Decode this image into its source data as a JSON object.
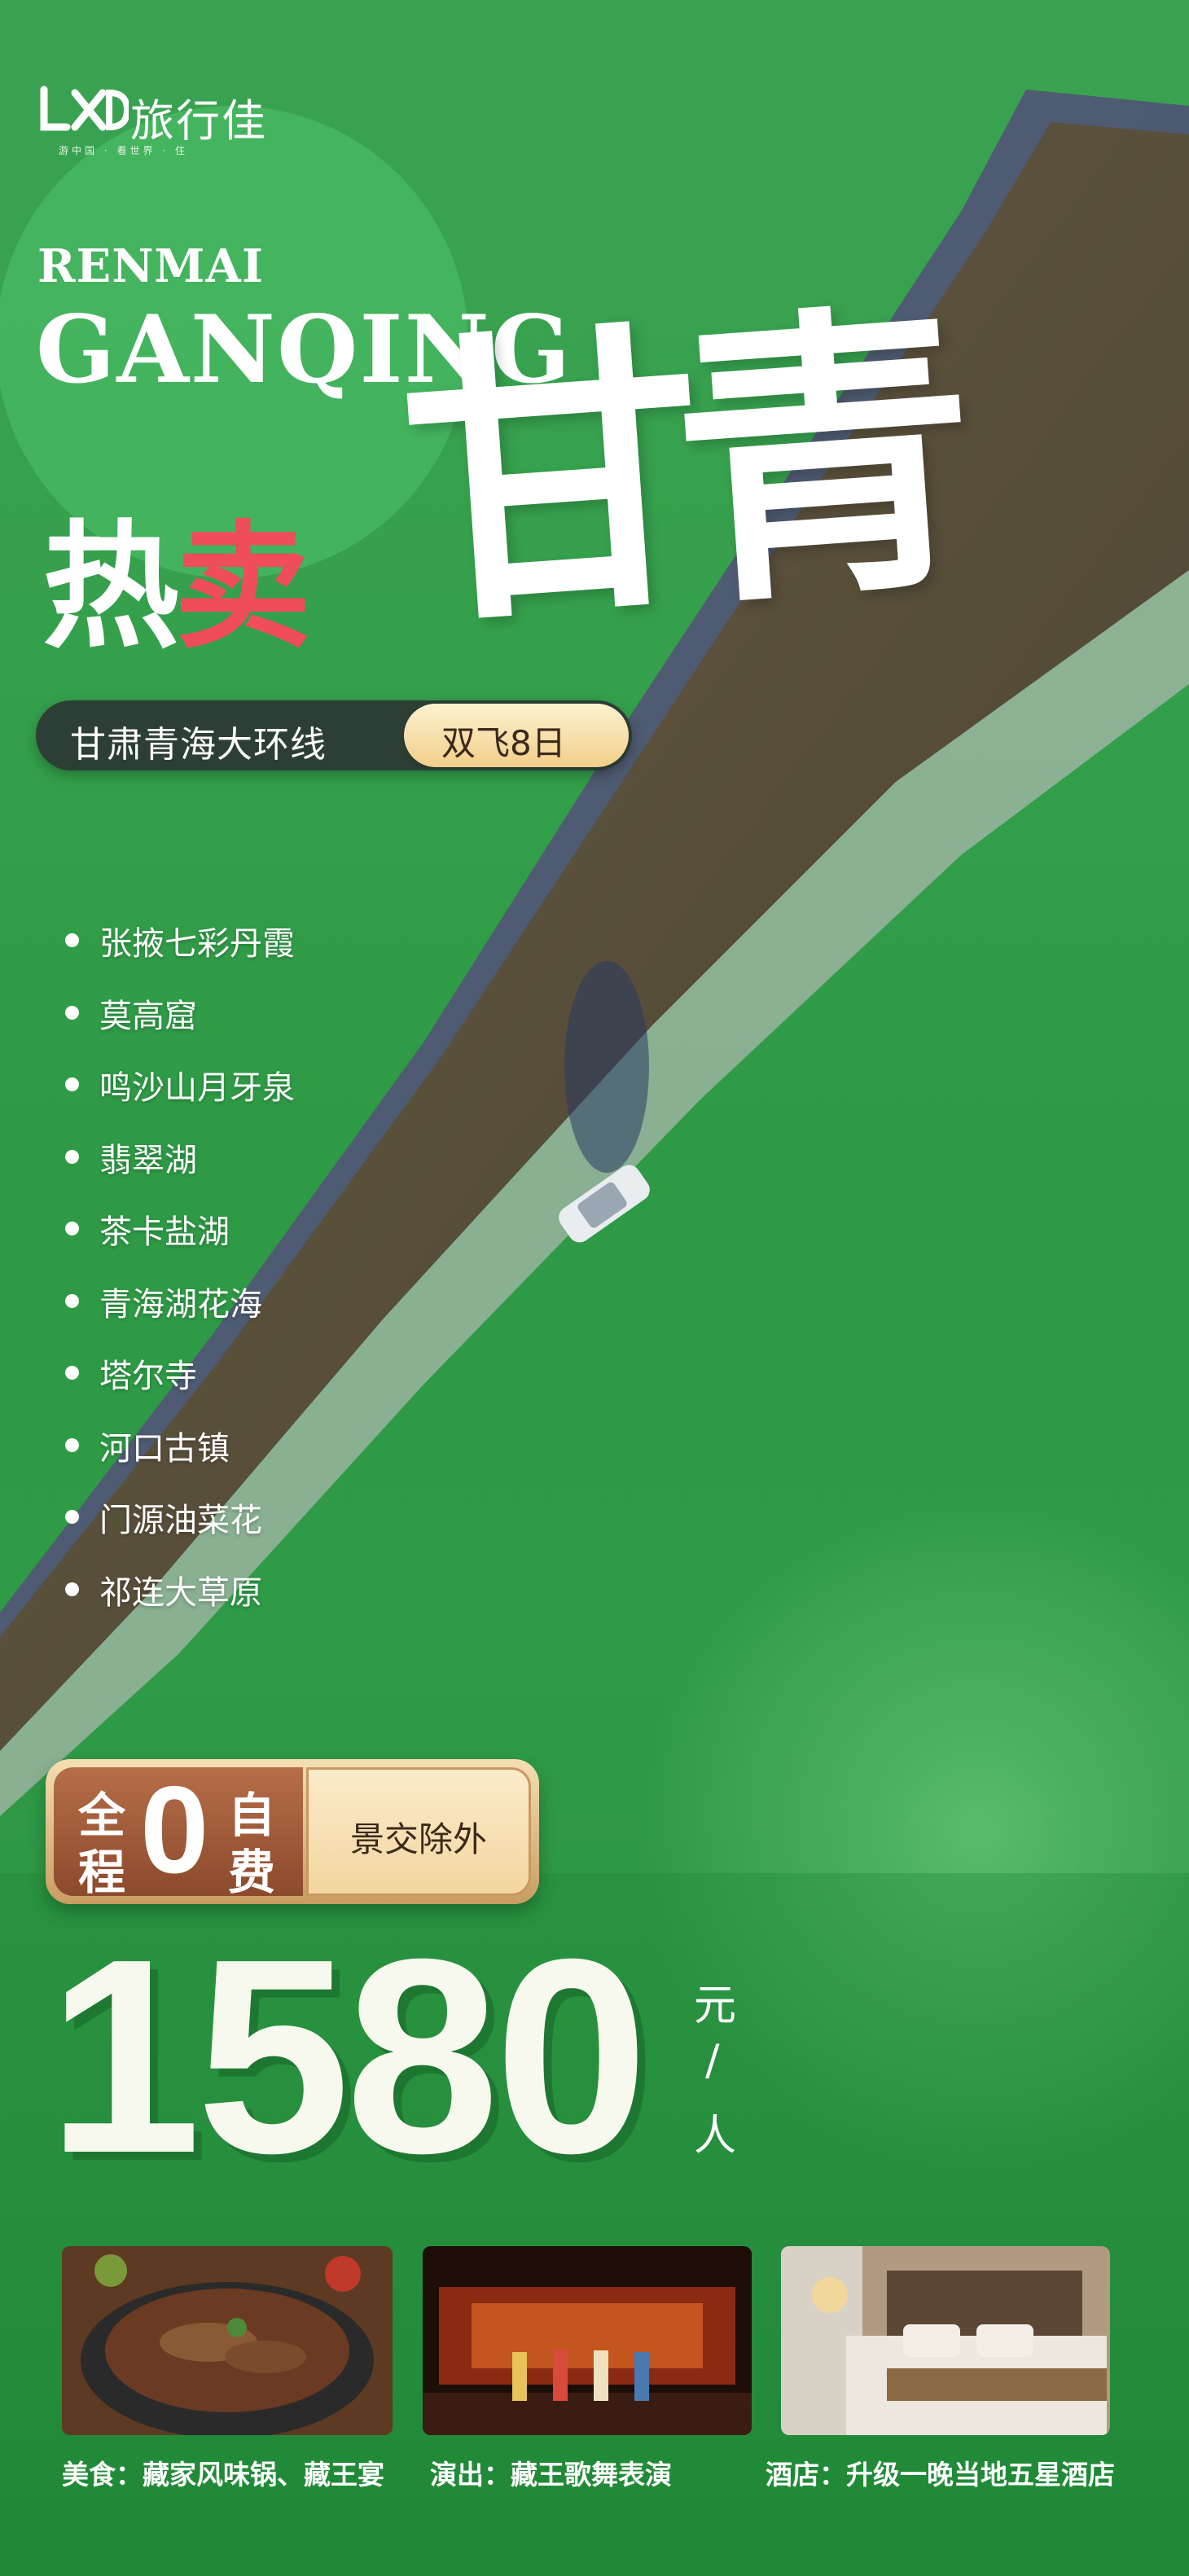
{
  "brand": {
    "logo_text": "旅行佳",
    "slogan": "游中国 · 看世界 · 住"
  },
  "headline": {
    "en_line1": "RENMAI",
    "en_line2": "GANQING",
    "hot_white": "热",
    "hot_red": "卖",
    "title": "甘青"
  },
  "route": {
    "name": "甘肃青海大环线",
    "tag": "双飞8日"
  },
  "spots": [
    "张掖七彩丹霞",
    "莫高窟",
    "鸣沙山月牙泉",
    "翡翠湖",
    "茶卡盐湖",
    "青海湖花海",
    "塔尔寺",
    "河口古镇",
    "门源油菜花",
    "祁连大草原"
  ],
  "badge": {
    "chars": {
      "quan": "全",
      "cheng": "程",
      "zi": "自",
      "fei": "费"
    },
    "zero": "0",
    "note": "景交除外"
  },
  "price": {
    "value": "1580",
    "unit_yuan": "元",
    "unit_slash": "/",
    "unit_ren": "人"
  },
  "features": [
    {
      "caption": "美食：藏家风味锅、藏王宴",
      "photo": "hotpot-photo"
    },
    {
      "caption": "演出：藏王歌舞表演",
      "photo": "show-photo"
    },
    {
      "caption": "酒店：升级一晚当地五星酒店",
      "photo": "hotel-photo"
    }
  ],
  "colors": {
    "grass": "#35a04c",
    "road": "#5a4a3a",
    "hot_red": "#ef4d5a",
    "pill_gold": "#f1cf8a",
    "badge_brown": "#9a5434"
  }
}
